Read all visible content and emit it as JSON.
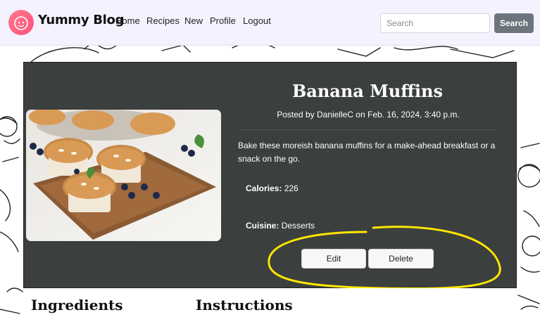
{
  "brand": {
    "name": "Yummy Blog"
  },
  "nav": {
    "items": [
      "Home",
      "Recipes",
      "New",
      "Profile",
      "Logout"
    ]
  },
  "search": {
    "placeholder": "Search",
    "button_label": "Search"
  },
  "recipe": {
    "title": "Banana Muffins",
    "posted": "Posted by DanielleC on Feb. 16, 2024, 3:40 p.m.",
    "description": "Bake these moreish banana muffins for a make-ahead breakfast or a snack on the go.",
    "calories_label": "Calories:",
    "calories_value": "226",
    "cuisine_label": "Cuisine:",
    "cuisine_value": "Desserts",
    "edit_label": "Edit",
    "delete_label": "Delete"
  },
  "sections": {
    "ingredients": "Ingredients",
    "instructions": "Instructions"
  },
  "colors": {
    "navbar_bg": "#f5f2ff",
    "card_bg": "#3b3f3e",
    "search_button": "#6c757d",
    "highlight": "#ffe600",
    "logo_gradient": [
      "#ff7a8a",
      "#ff4f7b"
    ]
  }
}
